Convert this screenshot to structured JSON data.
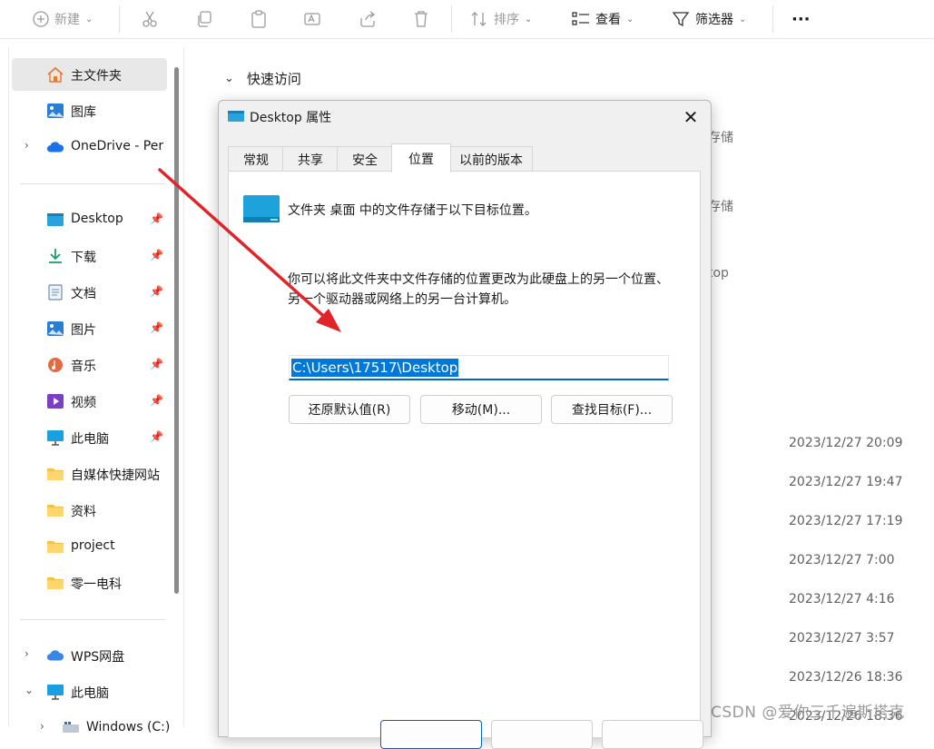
{
  "toolbar": {
    "new_label": "新建",
    "sort_label": "排序",
    "view_label": "查看",
    "filter_label": "筛选器",
    "more_label": "···"
  },
  "nav": {
    "items": [
      {
        "label": "主文件夹",
        "icon": "home-icon",
        "selected": true
      },
      {
        "label": "图库",
        "icon": "gallery-icon"
      },
      {
        "label": "OneDrive - Per",
        "icon": "onedrive-cloud-icon",
        "expandable": true
      },
      {
        "label": "Desktop",
        "icon": "desktop-folder-icon",
        "pinned": true
      },
      {
        "label": "下载",
        "icon": "download-icon",
        "pinned": true
      },
      {
        "label": "文档",
        "icon": "document-icon",
        "pinned": true
      },
      {
        "label": "图片",
        "icon": "pictures-icon",
        "pinned": true
      },
      {
        "label": "音乐",
        "icon": "music-icon",
        "pinned": true
      },
      {
        "label": "视频",
        "icon": "video-icon",
        "pinned": true
      },
      {
        "label": "此电脑",
        "icon": "this-pc-icon",
        "pinned": true
      },
      {
        "label": "自媒体快捷网站",
        "icon": "folder-icon"
      },
      {
        "label": "资料",
        "icon": "folder-icon"
      },
      {
        "label": "project",
        "icon": "folder-icon"
      },
      {
        "label": "零一电科",
        "icon": "folder-icon"
      },
      {
        "label": "WPS网盘",
        "icon": "wps-cloud-icon",
        "expandable": true
      },
      {
        "label": "此电脑",
        "icon": "this-pc-icon",
        "expanded": true
      },
      {
        "label": "Windows (C:)",
        "icon": "drive-icon"
      }
    ]
  },
  "content": {
    "quick_access_label": "快速访问",
    "peek_texts": [
      "存储",
      "存储",
      "top"
    ],
    "dates": [
      "2023/12/27 20:09",
      "2023/12/27 19:47",
      "2023/12/27 17:19",
      "2023/12/27 7:00",
      "2023/12/27 4:16",
      "2023/12/27 3:57",
      "2023/12/26 18:36",
      "2023/12/26 18:36"
    ],
    "watermark": "CSDN @爱你三千遍斯塔克"
  },
  "dialog": {
    "title": "Desktop 属性",
    "close_label": "✕",
    "tabs": [
      "常规",
      "共享",
      "安全",
      "位置",
      "以前的版本"
    ],
    "active_tab": 3,
    "description_1": "文件夹 桌面 中的文件存储于以下目标位置。",
    "description_2": "你可以将此文件夹中文件存储的位置更改为此硬盘上的另一个位置、另一个驱动器或网络上的另一台计算机。",
    "path_value": "C:\\Users\\17517\\Desktop",
    "buttons": {
      "restore": "还原默认值(R)",
      "move": "移动(M)...",
      "find_target": "查找目标(F)..."
    }
  },
  "colors": {
    "accent": "#0078d7",
    "arrow": "#e0242a",
    "folder": "#f5c24c"
  }
}
